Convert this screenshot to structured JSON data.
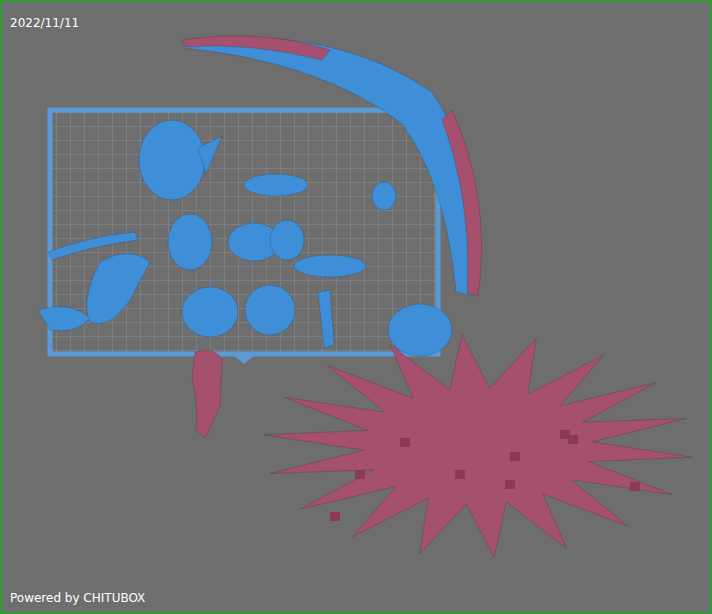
{
  "viewport": {
    "timestamp": "2022/11/11",
    "watermark": "Powered by CHITUBOX"
  },
  "parts": [
    {
      "highlighted": false
    },
    {
      "highlighted": false
    },
    {
      "highlighted": false
    },
    {
      "highlighted": true
    },
    {
      "highlighted": false
    },
    {
      "highlighted": false
    },
    {
      "highlighted": false
    },
    {
      "highlighted": false
    },
    {
      "highlighted": false
    },
    {
      "highlighted": false
    },
    {
      "highlighted": false
    },
    {
      "highlighted": false
    },
    {
      "highlighted": false
    },
    {
      "highlighted": false
    },
    {
      "highlighted": false
    },
    {
      "highlighted": false
    },
    {
      "highlighted": false
    },
    {
      "highlighted": true
    },
    {
      "highlighted": true
    }
  ]
}
